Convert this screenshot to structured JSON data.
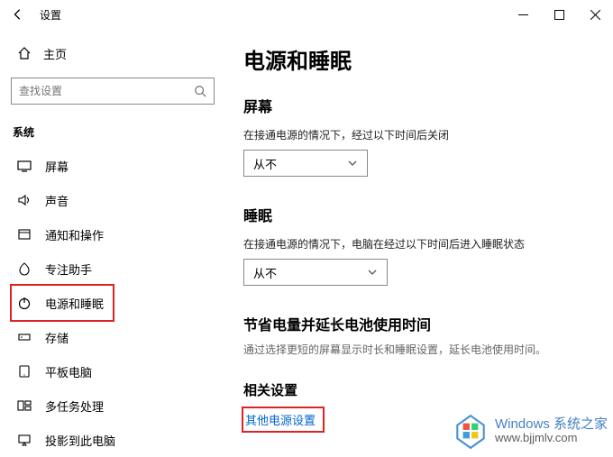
{
  "titlebar": {
    "title": "设置"
  },
  "sidebar": {
    "home": "主页",
    "search_placeholder": "查找设置",
    "group": "系统",
    "items": [
      {
        "icon": "display",
        "label": "屏幕"
      },
      {
        "icon": "sound",
        "label": "声音"
      },
      {
        "icon": "notify",
        "label": "通知和操作"
      },
      {
        "icon": "focus",
        "label": "专注助手"
      },
      {
        "icon": "power",
        "label": "电源和睡眠",
        "selected": true
      },
      {
        "icon": "storage",
        "label": "存储"
      },
      {
        "icon": "tablet",
        "label": "平板电脑"
      },
      {
        "icon": "multitask",
        "label": "多任务处理"
      },
      {
        "icon": "project",
        "label": "投影到此电脑"
      }
    ]
  },
  "main": {
    "heading": "电源和睡眠",
    "screen": {
      "title": "屏幕",
      "desc": "在接通电源的情况下，经过以下时间后关闭",
      "value": "从不"
    },
    "sleep": {
      "title": "睡眠",
      "desc": "在接通电源的情况下，电脑在经过以下时间后进入睡眠状态",
      "value": "从不"
    },
    "battery": {
      "title": "节省电量并延长电池使用时间",
      "desc": "通过选择更短的屏幕显示时长和睡眠设置，延长电池使用时间。"
    },
    "related": {
      "title": "相关设置",
      "link": "其他电源设置"
    }
  },
  "watermark": {
    "line1": "Windows 系统之家",
    "line2": "www.bjjmlv.com"
  }
}
